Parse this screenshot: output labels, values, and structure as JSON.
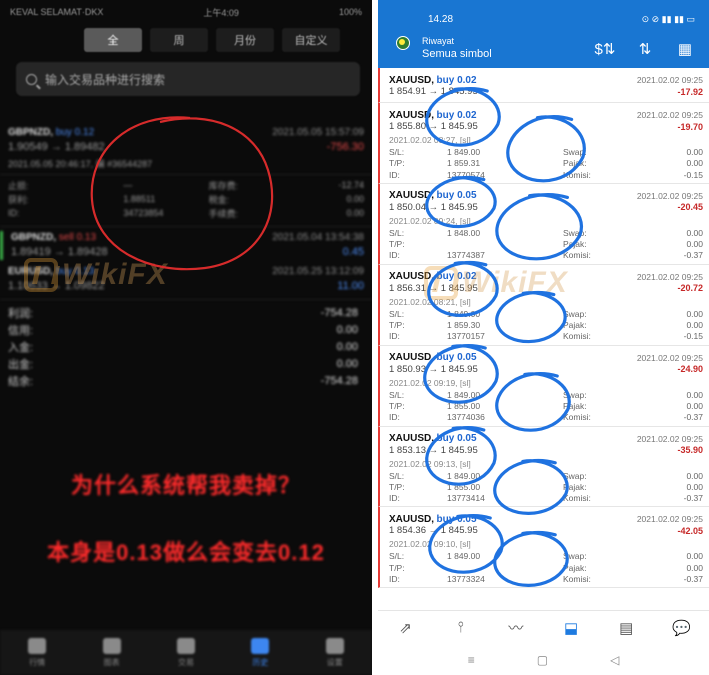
{
  "left": {
    "status": {
      "carrier": "KEVAL SELAMAT·DKX",
      "time": "上午4:09",
      "battery": "100%"
    },
    "tabs": [
      {
        "label": "全",
        "active": true
      },
      {
        "label": "周",
        "active": false
      },
      {
        "label": "月份",
        "active": false
      },
      {
        "label": "自定义",
        "active": false
      }
    ],
    "search_placeholder": "输入交易品种进行搜索",
    "positions": [
      {
        "symbol": "GBPNZD,",
        "side": "buy 0.12",
        "side_color": "blue",
        "time": "2021.05.05 15:57:09",
        "prices": "1.90549 → 1.89482",
        "profit": "-756.30",
        "profit_color": "red"
      },
      {
        "symbol": "GBPNZD,",
        "side": "sell 0.13",
        "side_color": "red",
        "time": "2021.05.04 13:54:38",
        "prices": "1.89419 → 1.89428",
        "profit": "0.45",
        "profit_color": "blue"
      },
      {
        "symbol": "EURUSD,",
        "side": "buy 0.13",
        "side_color": "blue",
        "time": "2021.05.25 13:12:09",
        "prices": "1.10633 → 1.09822",
        "profit": "11.00",
        "profit_color": "blue"
      }
    ],
    "detail_time": "2021.05.05 20:46:17, 编 #36544287",
    "details": [
      {
        "label": "止损:",
        "mid": "—",
        "key": "库存费:",
        "value": "-12.74"
      },
      {
        "label": "获利:",
        "mid": "1.88511",
        "key": "税金:",
        "value": "0.00"
      },
      {
        "label": "ID:",
        "mid": "34723854",
        "key": "手续费:",
        "value": "0.00"
      }
    ],
    "summary": [
      {
        "label": "利润:",
        "value": "-754.28"
      },
      {
        "label": "信用:",
        "value": "0.00"
      },
      {
        "label": "入金:",
        "value": "0.00"
      },
      {
        "label": "出金:",
        "value": "0.00"
      },
      {
        "label": "结余:",
        "value": "-754.28"
      }
    ],
    "question1": "为什么系统帮我卖掉？",
    "question2": "本身是0.13做么会变去0.12",
    "nav": [
      {
        "label": "行情",
        "active": false
      },
      {
        "label": "图表",
        "active": false
      },
      {
        "label": "交易",
        "active": false
      },
      {
        "label": "历史",
        "active": true
      },
      {
        "label": "设置",
        "active": false
      }
    ]
  },
  "right": {
    "status_time": "14.28",
    "status_icons": "⊙ ⊘ ▮▮ ▮▮ ▭",
    "header_title": "Riwayat",
    "header_subtitle": "Semua simbol",
    "icons": {
      "a": "$⇅",
      "b": "⇅",
      "c": "▦"
    },
    "first_item": {
      "symbol": "XAUUSD,",
      "side": "buy 0.02",
      "date": "2021.02.02 09:25",
      "prices": "1 854.91 → 1 845.95",
      "profit": "-17.92"
    },
    "items": [
      {
        "symbol": "XAUUSD,",
        "side": "buy 0.02",
        "date": "2021.02.02 09:25",
        "prices": "1 855.80 → 1 845.95",
        "profit": "-19.70",
        "open": "2021.02.02 08:27, [sl]",
        "sl": "1 849.00",
        "tp": "1 859.31",
        "id": "13770574",
        "swap": "0.00",
        "pajak": "0.00",
        "komisi": "-0.15"
      },
      {
        "symbol": "XAUUSD,",
        "side": "buy 0.05",
        "date": "2021.02.02 09:25",
        "prices": "1 850.04 → 1 845.95",
        "profit": "-20.45",
        "open": "2021.02.02 09:24, [sl]",
        "sl": "1 848.00",
        "tp": "",
        "id": "13774387",
        "swap": "0.00",
        "pajak": "0.00",
        "komisi": "-0.37"
      },
      {
        "symbol": "XAUUSD,",
        "side": "buy 0.02",
        "date": "2021.02.02 09:25",
        "prices": "1 856.31 → 1 845.95",
        "profit": "-20.72",
        "open": "2021.02.02 08:21, [sl]",
        "sl": "1 849.00",
        "tp": "1 859.30",
        "id": "13770157",
        "swap": "0.00",
        "pajak": "0.00",
        "komisi": "-0.15"
      },
      {
        "symbol": "XAUUSD,",
        "side": "buy 0.05",
        "date": "2021.02.02 09:25",
        "prices": "1 850.93 → 1 845.95",
        "profit": "-24.90",
        "open": "2021.02.02 09:19, [sl]",
        "sl": "1 849.00",
        "tp": "1 855.00",
        "id": "13774036",
        "swap": "0.00",
        "pajak": "0.00",
        "komisi": "-0.37"
      },
      {
        "symbol": "XAUUSD,",
        "side": "buy 0.05",
        "date": "2021.02.02 09:25",
        "prices": "1 853.13 → 1 845.95",
        "profit": "-35.90",
        "open": "2021.02.02 09:13, [sl]",
        "sl": "1 849.00",
        "tp": "1 855.00",
        "id": "13773414",
        "swap": "0.00",
        "pajak": "0.00",
        "komisi": "-0.37"
      },
      {
        "symbol": "XAUUSD,",
        "side": "buy 0.05",
        "date": "2021.02.02 09:25",
        "prices": "1 854.36 → 1 845.95",
        "profit": "-42.05",
        "open": "2021.02.02 09:10, [sl]",
        "sl": "1 849.00",
        "tp": "",
        "id": "13773324",
        "swap": "0.00",
        "pajak": "0.00",
        "komisi": "-0.37"
      }
    ],
    "labels": {
      "sl": "S/L:",
      "tp": "T/P:",
      "id": "ID:",
      "swap": "Swap:",
      "pajak": "Pajak:",
      "komisi": "Komisi:"
    },
    "nav": [
      {
        "icon": "⇗",
        "active": false
      },
      {
        "icon": "⫯",
        "active": false
      },
      {
        "icon": "〰",
        "active": false
      },
      {
        "icon": "⬓",
        "active": true
      },
      {
        "icon": "▤",
        "active": false
      },
      {
        "icon": "💬",
        "active": false
      }
    ],
    "sys": [
      "≡",
      "▢",
      "◁"
    ]
  },
  "watermark": "WikiFX",
  "colors": {
    "mt_blue": "#1976d2",
    "loss_red": "#c62828",
    "circle_blue": "#1f72e0",
    "question_red": "#ff2b2b"
  }
}
